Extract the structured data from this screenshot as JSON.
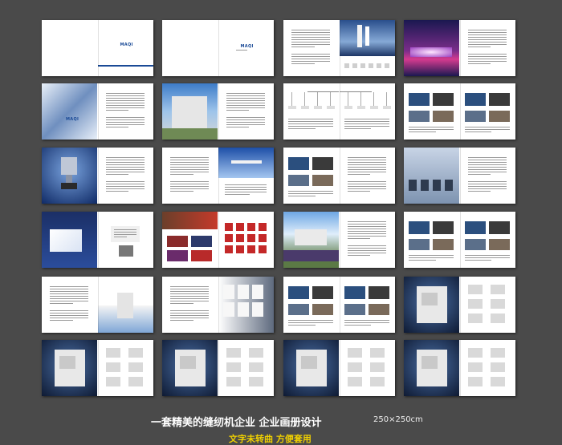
{
  "caption": {
    "main": "一套精美的缝纫机企业 企业画册设计",
    "size": "250×250cm",
    "sub": "文字未转曲 方便套用"
  },
  "brand": {
    "logo_text": "MAQI"
  },
  "spreads": [
    {
      "id": "cover",
      "left": "blank",
      "right": "logo-cover"
    },
    {
      "id": "title",
      "left": "blank",
      "right": "logo-title"
    },
    {
      "id": "sailboat",
      "left": "text",
      "right": "sailboat-photo"
    },
    {
      "id": "stadium",
      "left": "stadium-photo",
      "right": "text"
    },
    {
      "id": "building-wall",
      "left": "building-photo",
      "right": "text"
    },
    {
      "id": "factory",
      "left": "factory-photo",
      "right": "text"
    },
    {
      "id": "org-chart",
      "left": "org-chart",
      "right": "org-chart"
    },
    {
      "id": "team",
      "left": "photos",
      "right": "photos"
    },
    {
      "id": "trophy",
      "left": "trophy-photo",
      "right": "text"
    },
    {
      "id": "airplane",
      "left": "text",
      "right": "airplane-photo"
    },
    {
      "id": "workshop",
      "left": "photos",
      "right": "text"
    },
    {
      "id": "office",
      "left": "office-photo",
      "right": "text"
    },
    {
      "id": "product-box",
      "left": "product-photo",
      "right": "diagram"
    },
    {
      "id": "events",
      "left": "event-photos",
      "right": "icon-grid"
    },
    {
      "id": "campus",
      "left": "campus-photo",
      "right": "text"
    },
    {
      "id": "exhibition",
      "left": "photos",
      "right": "photos"
    },
    {
      "id": "machine-intro",
      "left": "text",
      "right": "machine-photo"
    },
    {
      "id": "certificates",
      "left": "text",
      "right": "certificates"
    },
    {
      "id": "plant-photos",
      "left": "photos",
      "right": "photos"
    },
    {
      "id": "machine-hero-1",
      "left": "machine-hero",
      "right": "machine-grid"
    },
    {
      "id": "machine-hero-2",
      "left": "machine-hero",
      "right": "machine-grid"
    },
    {
      "id": "machine-hero-3",
      "left": "machine-hero",
      "right": "machine-grid"
    },
    {
      "id": "machine-hero-4",
      "left": "machine-hero",
      "right": "machine-grid"
    },
    {
      "id": "machine-hero-5",
      "left": "machine-hero",
      "right": "machine-grid"
    }
  ],
  "colors": {
    "background": "#4a4a4a",
    "brand_blue": "#1a4a96",
    "caption_white": "#ffffff",
    "caption_yellow": "#f0d000"
  }
}
